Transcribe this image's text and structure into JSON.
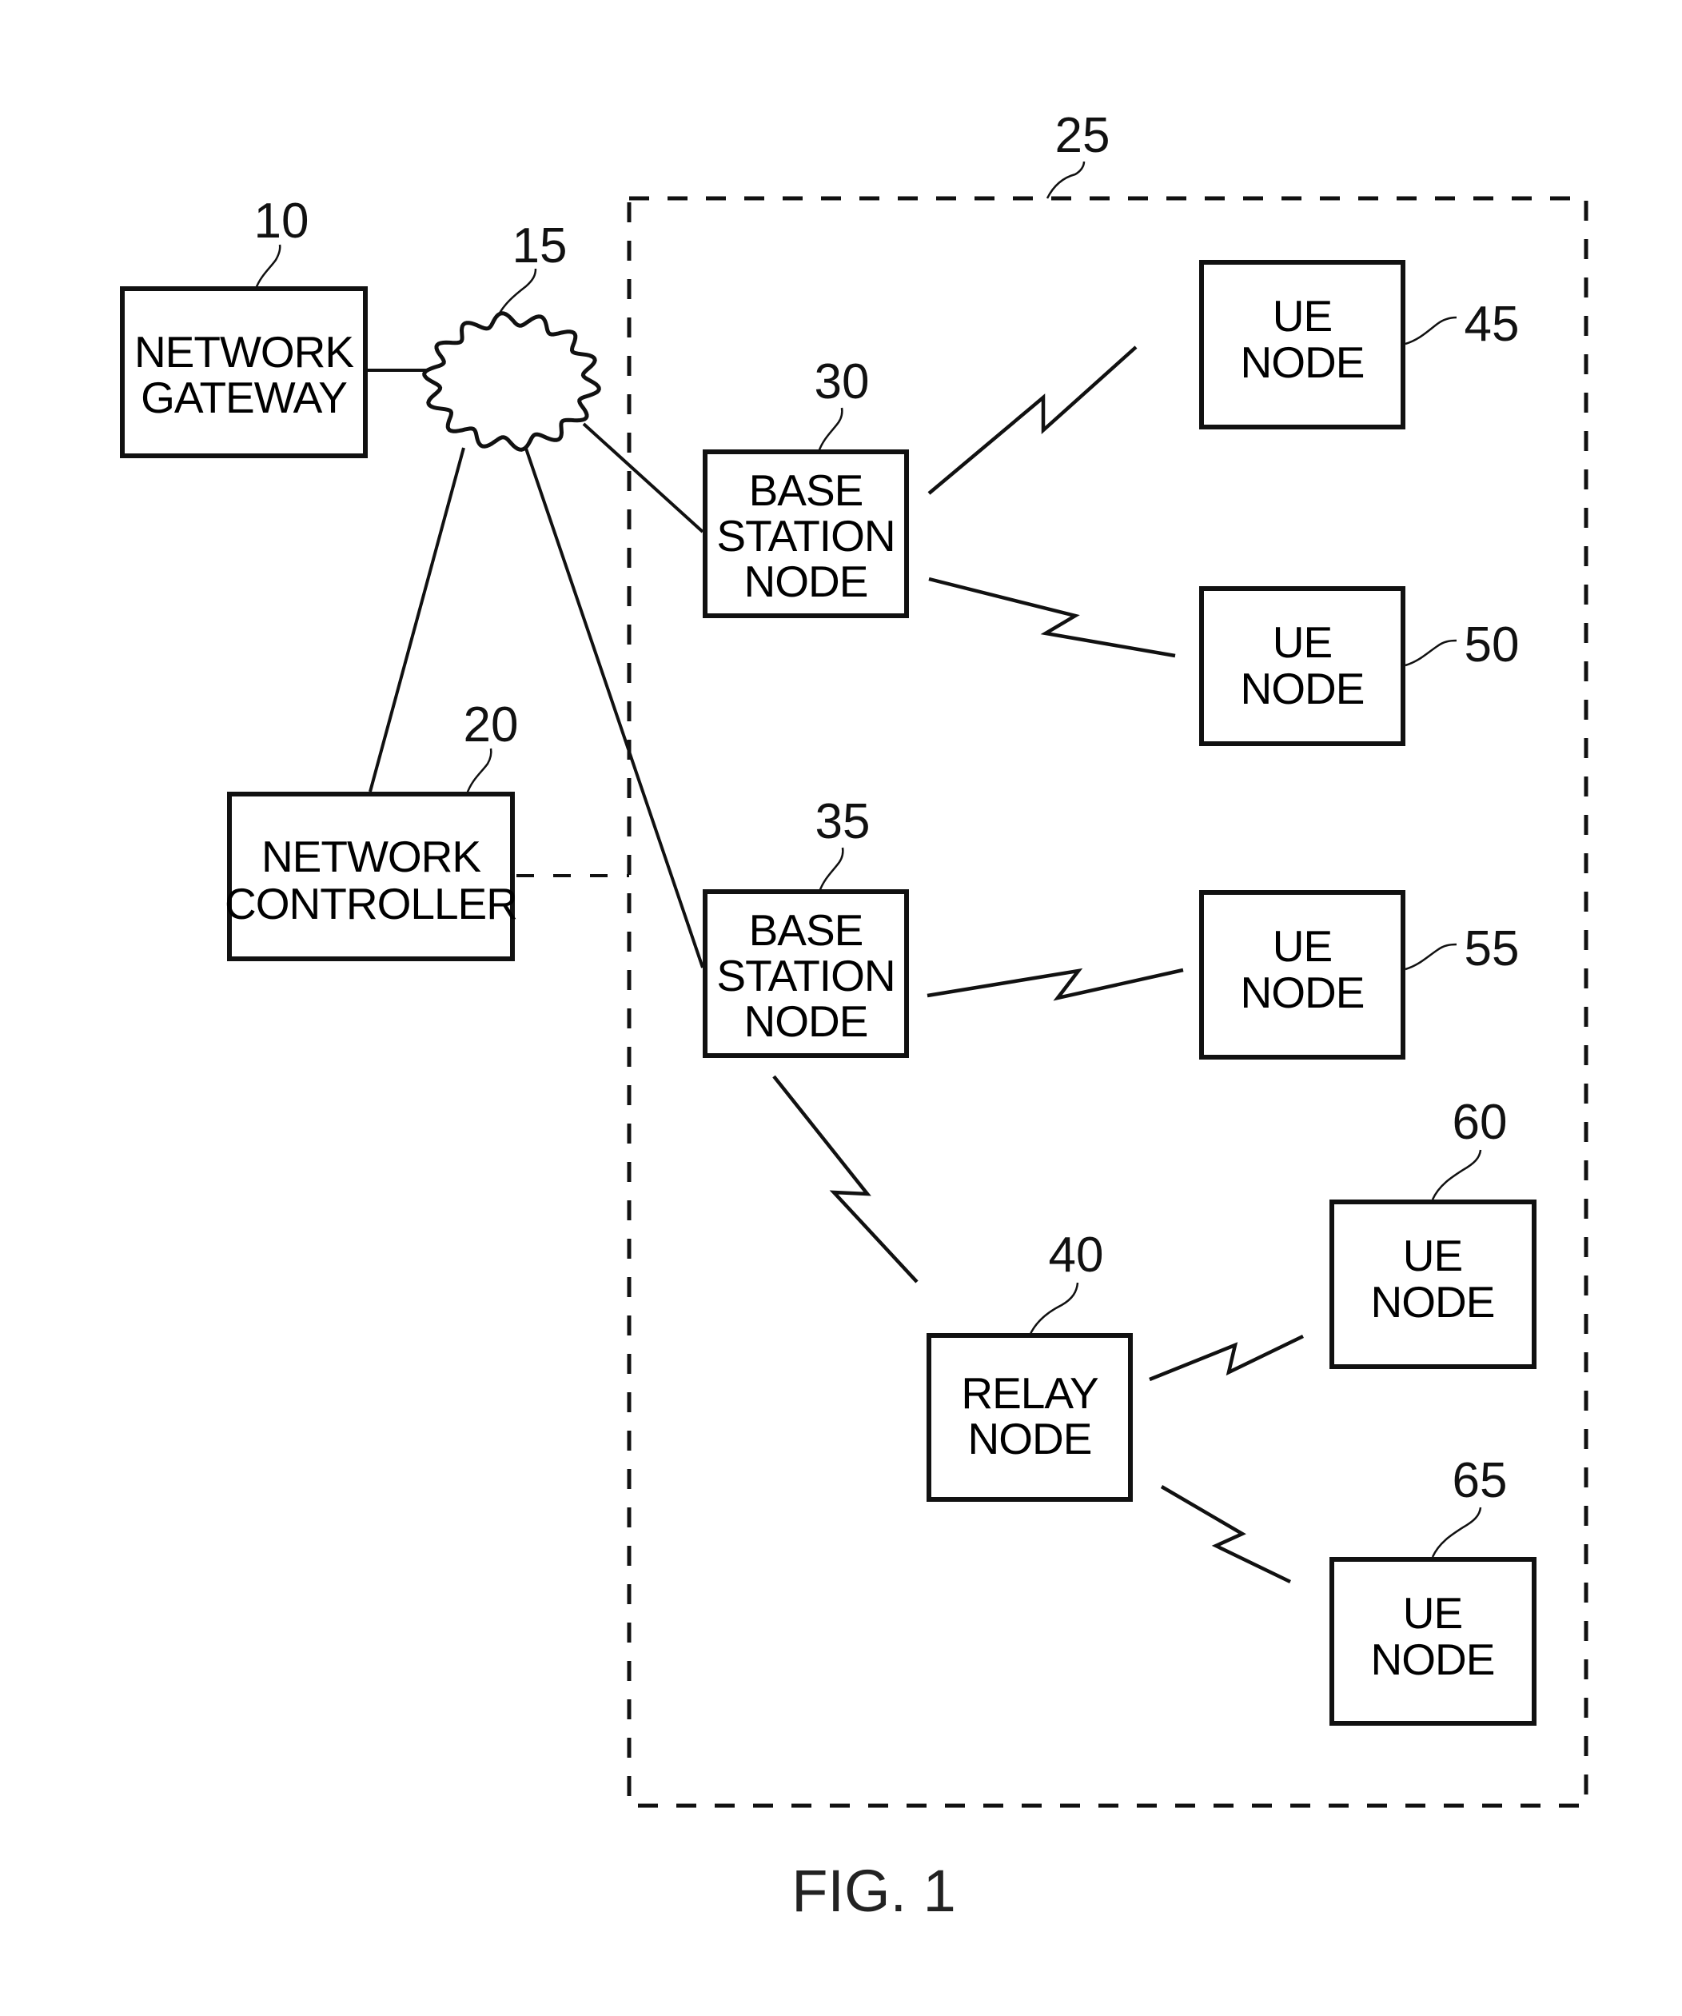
{
  "figure": {
    "caption": "FIG. 1",
    "system_boundary_ref": "25",
    "network_cloud_ref": "15"
  },
  "nodes": {
    "network_gateway": {
      "ref": "10",
      "lines": [
        "NETWORK",
        "GATEWAY"
      ]
    },
    "network_controller": {
      "ref": "20",
      "lines": [
        "NETWORK",
        "CONTROLLER"
      ]
    },
    "base_station_30": {
      "ref": "30",
      "lines": [
        "BASE",
        "STATION",
        "NODE"
      ]
    },
    "base_station_35": {
      "ref": "35",
      "lines": [
        "BASE",
        "STATION",
        "NODE"
      ]
    },
    "relay_node": {
      "ref": "40",
      "lines": [
        "RELAY",
        "NODE"
      ]
    },
    "ue_45": {
      "ref": "45",
      "lines": [
        "UE",
        "NODE"
      ]
    },
    "ue_50": {
      "ref": "50",
      "lines": [
        "UE",
        "NODE"
      ]
    },
    "ue_55": {
      "ref": "55",
      "lines": [
        "UE",
        "NODE"
      ]
    },
    "ue_60": {
      "ref": "60",
      "lines": [
        "UE",
        "NODE"
      ]
    },
    "ue_65": {
      "ref": "65",
      "lines": [
        "UE",
        "NODE"
      ]
    }
  },
  "connections": {
    "wired": [
      [
        "network_gateway",
        "network_cloud"
      ],
      [
        "network_cloud",
        "network_controller"
      ],
      [
        "network_cloud",
        "base_station_30"
      ],
      [
        "network_cloud",
        "base_station_35"
      ]
    ],
    "control_dashed": [
      [
        "network_controller",
        "system_boundary"
      ]
    ],
    "wireless": [
      [
        "base_station_30",
        "ue_45"
      ],
      [
        "base_station_30",
        "ue_50"
      ],
      [
        "base_station_35",
        "ue_55"
      ],
      [
        "base_station_35",
        "relay_node"
      ],
      [
        "relay_node",
        "ue_60"
      ],
      [
        "relay_node",
        "ue_65"
      ]
    ]
  }
}
